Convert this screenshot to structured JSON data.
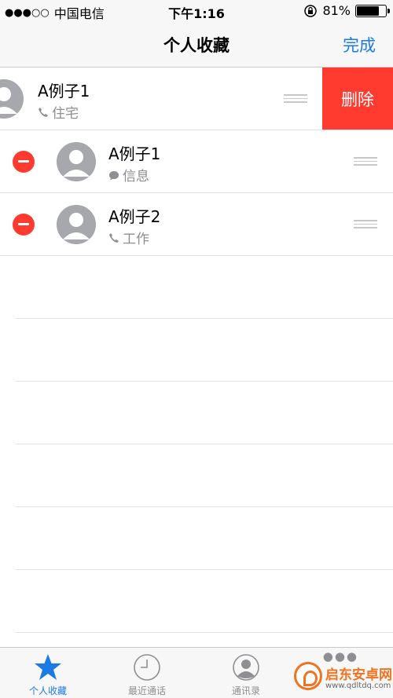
{
  "status": {
    "signal": "●●●○○",
    "carrier": "中国电信",
    "time": "下午1:16",
    "battery": "81%",
    "battery_level": 0.81
  },
  "nav": {
    "title": "个人收藏",
    "done_label": "完成"
  },
  "favorites": [
    {
      "name": "A例子1",
      "type": "住宅",
      "type_icon": "phone-icon",
      "swiped": true,
      "delete_label": "删除"
    },
    {
      "name": "A例子1",
      "type": "信息",
      "type_icon": "message-icon",
      "swiped": false
    },
    {
      "name": "A例子2",
      "type": "工作",
      "type_icon": "phone-icon",
      "swiped": false
    }
  ],
  "tabs": [
    {
      "label": "个人收藏",
      "icon": "star-icon",
      "active": true
    },
    {
      "label": "最近通话",
      "icon": "clock-icon",
      "active": false
    },
    {
      "label": "通讯录",
      "icon": "contacts-icon",
      "active": false
    },
    {
      "label": "",
      "icon": "keypad-icon",
      "active": false
    }
  ],
  "watermark": {
    "name": "启东安卓网",
    "url": "www.qdltdq.com"
  },
  "colors": {
    "accent": "#1a7ae6",
    "delete": "#ff3b30"
  }
}
